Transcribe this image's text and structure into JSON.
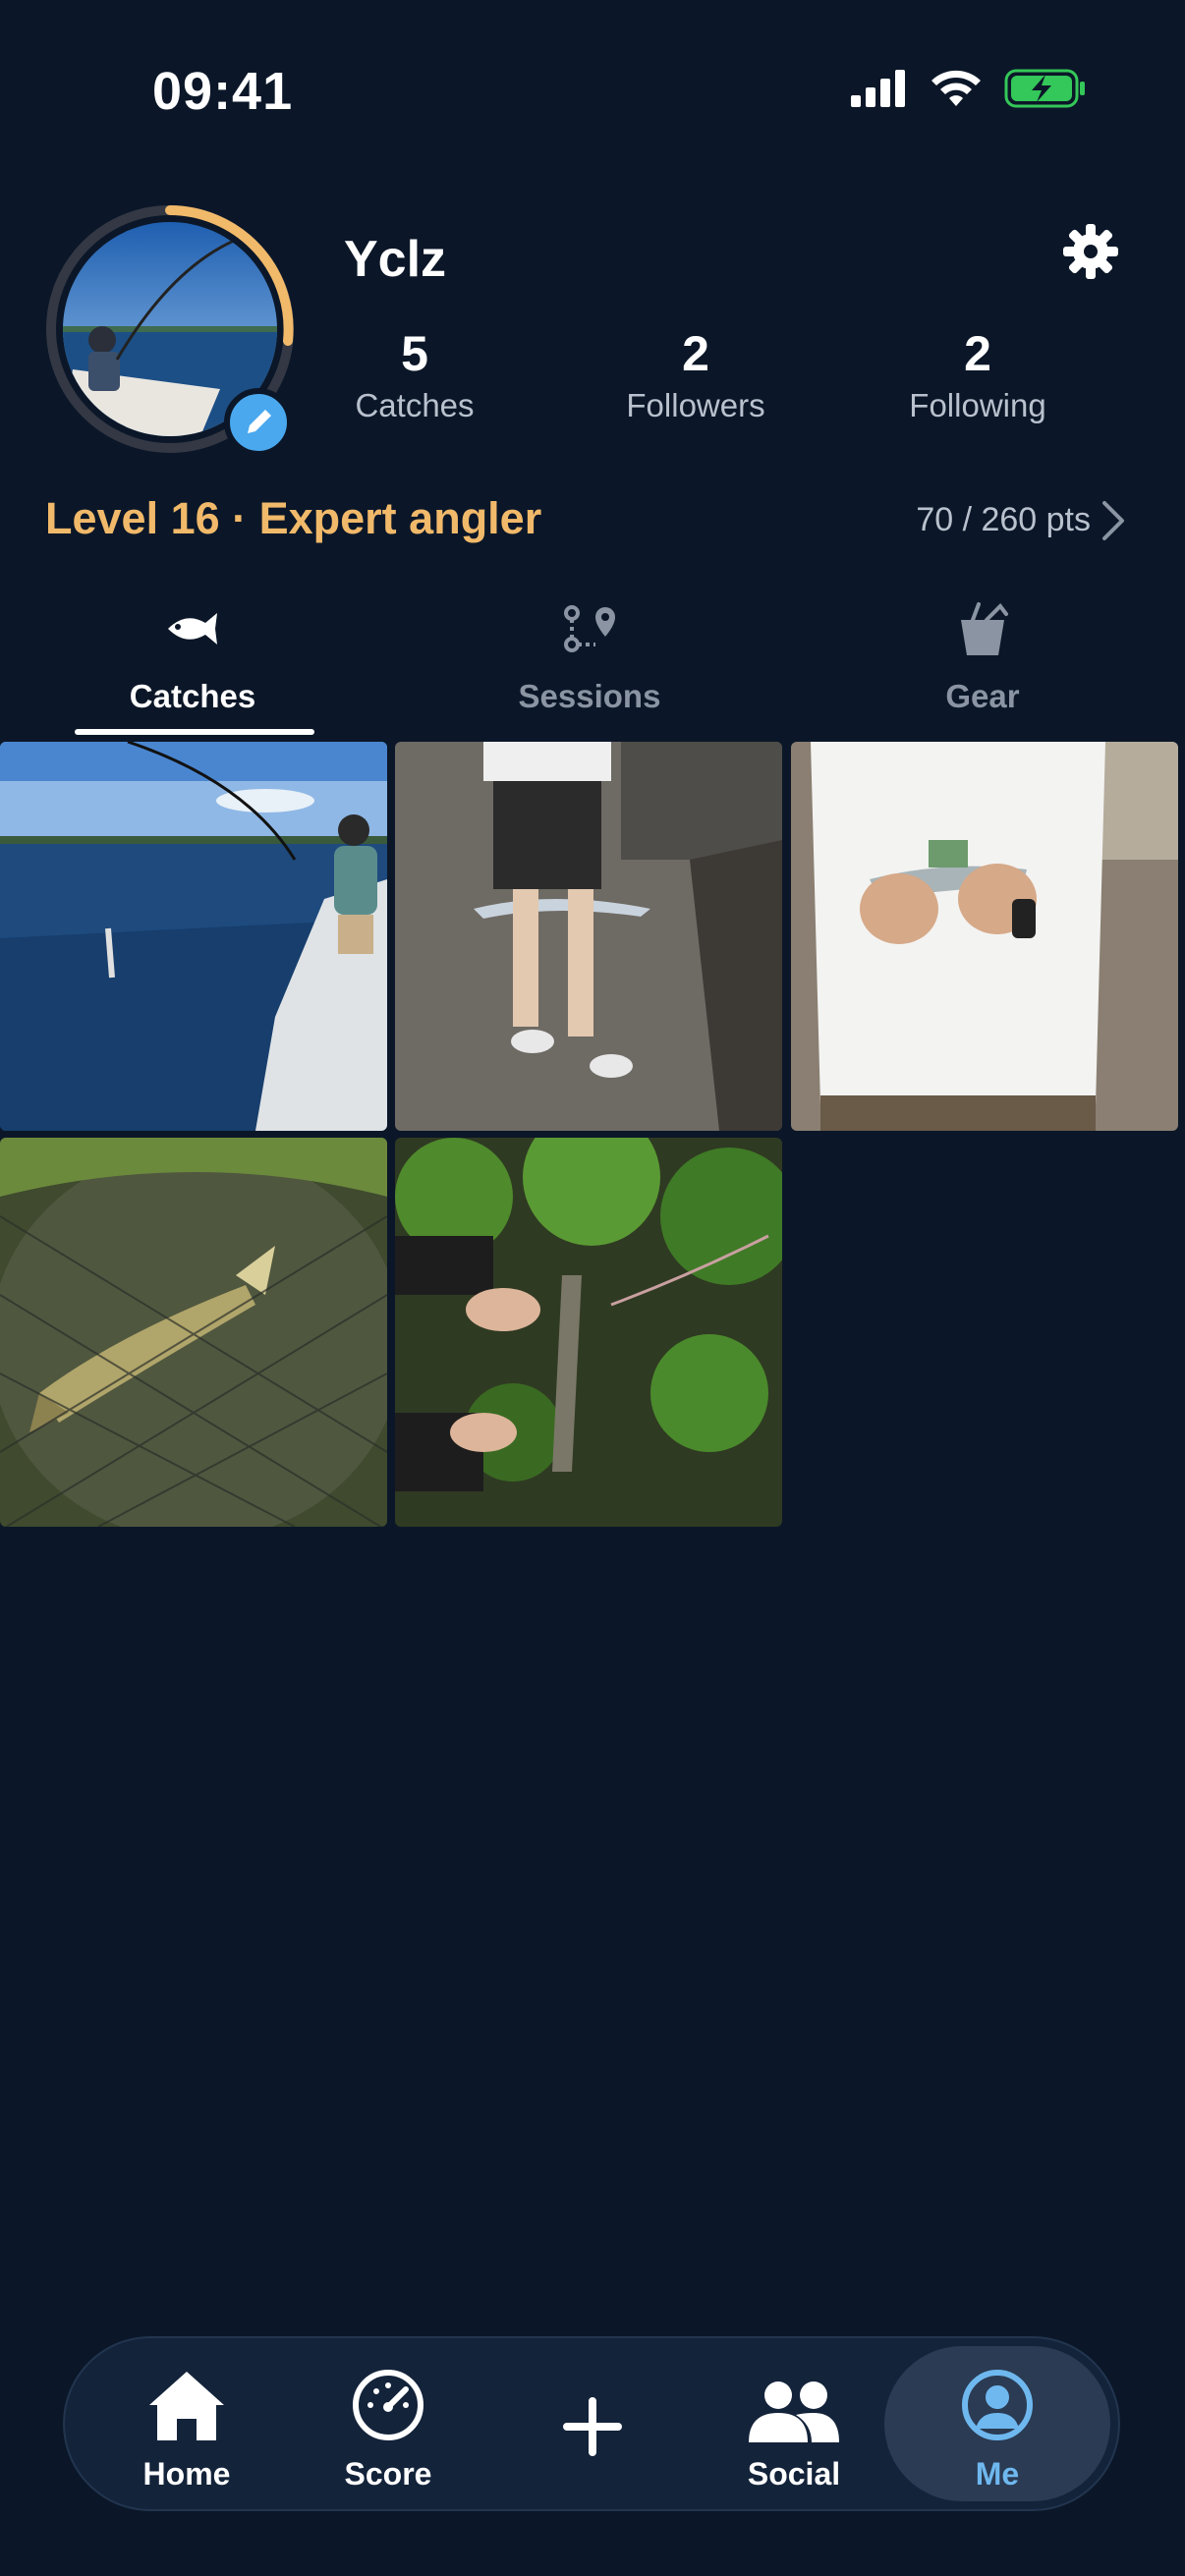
{
  "status_bar": {
    "time": "09:41"
  },
  "profile": {
    "username": "Yclz",
    "stats": [
      {
        "value": "5",
        "label": "Catches"
      },
      {
        "value": "2",
        "label": "Followers"
      },
      {
        "value": "2",
        "label": "Following"
      }
    ],
    "level_text": "Level 16 · Expert angler",
    "points_text": "70 / 260 pts",
    "level_progress": 0.27
  },
  "tabs": [
    {
      "label": "Catches",
      "icon": "fish-icon",
      "active": true
    },
    {
      "label": "Sessions",
      "icon": "route-icon",
      "active": false
    },
    {
      "label": "Gear",
      "icon": "bucket-icon",
      "active": false
    }
  ],
  "catches": [
    {
      "name": "catch-photo-boat"
    },
    {
      "name": "catch-photo-pier"
    },
    {
      "name": "catch-photo-tshirt"
    },
    {
      "name": "catch-photo-net"
    },
    {
      "name": "catch-photo-plants"
    }
  ],
  "bottom_nav": [
    {
      "label": "Home",
      "icon": "home-icon"
    },
    {
      "label": "Score",
      "icon": "speedometer-icon"
    },
    {
      "label": "",
      "icon": "plus-icon"
    },
    {
      "label": "Social",
      "icon": "people-icon"
    },
    {
      "label": "Me",
      "icon": "user-circle-icon",
      "active": true
    }
  ],
  "colors": {
    "background": "#0b1728",
    "accent_gold": "#f1b96a",
    "accent_blue": "#4aa8ee",
    "nav_active": "#6fb8ef"
  }
}
